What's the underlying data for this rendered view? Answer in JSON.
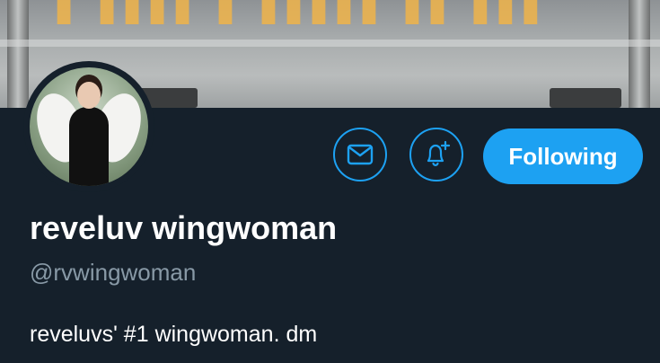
{
  "profile": {
    "display_name": "reveluv wingwoman",
    "handle": "@rvwingwoman",
    "bio": "reveluvs' #1 wingwoman. dm"
  },
  "actions": {
    "message_icon": "envelope-icon",
    "notify_icon": "bell-plus-icon",
    "follow_label": "Following"
  },
  "colors": {
    "background": "#15202b",
    "accent": "#1da1f2",
    "secondary_text": "#8899a6"
  }
}
